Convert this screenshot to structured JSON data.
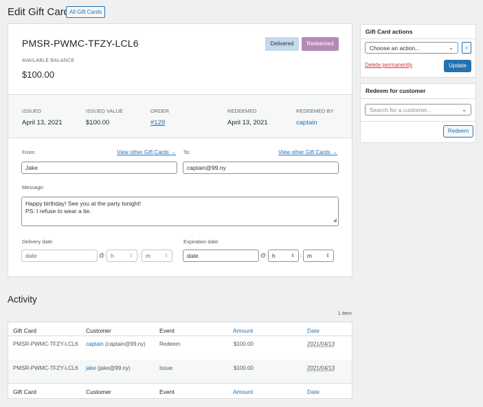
{
  "page": {
    "title": "Edit Gift Card",
    "all_gift_cards_label": "All Gift Cards"
  },
  "gift_card": {
    "code": "PMSR-PWMC-TFZY-LCL6",
    "badges": {
      "delivered": "Delivered",
      "redeemed": "Redeemed"
    },
    "available_balance_label": "AVAILABLE BALANCE",
    "available_balance": "$100.00"
  },
  "stats": {
    "issued_label": "ISSUED",
    "issued_value": "April 13, 2021",
    "issued_value_label": "ISSUED VALUE",
    "issued_value_value": "$100.00",
    "order_label": "ORDER",
    "order_value": "#129",
    "redeemed_label": "REDEEMED",
    "redeemed_value": "April 13, 2021",
    "redeemed_by_label": "REDEEMED BY",
    "redeemed_by_value": "captain"
  },
  "form": {
    "from_label": "From:",
    "from_link": "View other Gift Cards →",
    "from_value": "Jake",
    "to_label": "To:",
    "to_link": "View other Gift Cards →",
    "to_value": "captain@99.ny",
    "message_label": "Message:",
    "message_line1": "Happy birthday! See you at the party tonight!",
    "message_line2": "PS: I refuse to wear a tie.",
    "delivery_label": "Delivery date:",
    "expiration_label": "Expiration date:",
    "date_placeholder": "date",
    "hour_placeholder": "h",
    "minute_placeholder": "m",
    "at_sign": "@",
    "colon": ":"
  },
  "sidebar": {
    "actions_title": "Gift Card actions",
    "action_select_value": "Choose an action...",
    "arrow_label": "›",
    "delete_label": "Delete permanently",
    "update_label": "Update",
    "redeem_title": "Redeem for customer",
    "customer_search_placeholder": "Search for a customer...",
    "redeem_button_label": "Redeem"
  },
  "activity": {
    "title": "Activity",
    "count": "1 item",
    "columns": [
      "Gift Card",
      "Customer",
      "Event",
      "Amount",
      "Date"
    ],
    "rows": [
      {
        "gift_card": "PMSR-PWMC-TFZY-LCL6",
        "customer_name": "captain",
        "customer_email": "(captain@99.ny)",
        "event": "Redeem",
        "amount": "$100.00",
        "date": "2021/04/13"
      },
      {
        "gift_card": "PMSR-PWMC-TFZY-LCL6",
        "customer_name": "jake",
        "customer_email": "(jake@99.ny)",
        "event": "Issue",
        "amount": "$100.00",
        "date": "2021/04/13"
      }
    ]
  },
  "colors": {
    "accent": "#2271b1",
    "delivered_badge": "#c5d9ed",
    "redeemed_badge": "#b48bb4",
    "delete": "#d63638"
  },
  "icons": {
    "chevron": "chevron-down-icon",
    "spinner": "spinner-arrows-icon",
    "resize": "resize-handle-icon"
  }
}
